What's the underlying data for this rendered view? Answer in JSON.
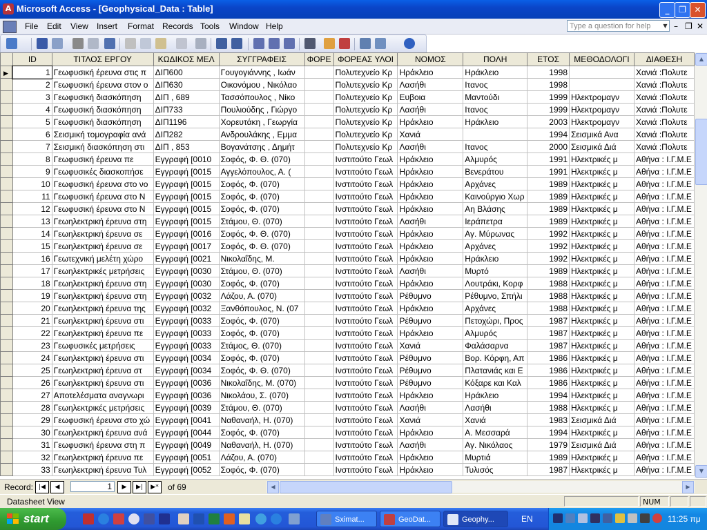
{
  "window": {
    "title": "Microsoft Access - [Geophysical_Data : Table]",
    "minimize_label": "_",
    "restore_label": "❐",
    "close_label": "✕"
  },
  "menu": {
    "items": [
      "File",
      "Edit",
      "View",
      "Insert",
      "Format",
      "Records",
      "Tools",
      "Window",
      "Help"
    ],
    "help_placeholder": "Type a question for help",
    "mdi_minimize": "–",
    "mdi_restore": "❐",
    "mdi_close": "✕"
  },
  "toolbar": {
    "icons": [
      "view-design-icon",
      "save-icon",
      "file-search-icon",
      "print-icon",
      "print-preview-icon",
      "spelling-icon",
      "cut-icon",
      "copy-icon",
      "paste-icon",
      "undo-icon",
      "insert-hyperlink-icon",
      "sort-ascending-icon",
      "sort-descending-icon",
      "filter-by-selection-icon",
      "filter-by-form-icon",
      "apply-filter-icon",
      "find-icon",
      "new-record-icon",
      "delete-record-icon",
      "properties-icon",
      "new-object-icon",
      "help-icon"
    ]
  },
  "table": {
    "columns": [
      "ID",
      "ΤΙΤΛΟΣ ΕΡΓΟΥ",
      "ΚΩΔΙΚΟΣ ΜΕΛ",
      "ΣΥΓΓΡΑΦΕΙΣ",
      "ΦΟΡΕ",
      "ΦΟΡΕΑΣ ΥΛΟΙ",
      "ΝΟΜΟΣ",
      "ΠΟΛΗ",
      "ΕΤΟΣ",
      "ΜΕΘΟΔΟΛΟΓΙ",
      "ΔΙΑΘΕΣΗ"
    ],
    "rows": [
      [
        "1",
        "Γεωφυσική έρευνα στις π",
        "ΔΙΠ600",
        "Γουγογιάννης , Ιωάν",
        "",
        "Πολυτεχνείο Κρ",
        "Ηράκλειο",
        "Ηράκλειο",
        "1998",
        "",
        "Χανιά :Πολυτε"
      ],
      [
        "2",
        "Γεωφυσική έρευνα στον ο",
        "ΔΙΠ630",
        "Οικονόμου , Νικόλαο",
        "",
        "Πολυτεχνείο Κρ",
        "Λασήθι",
        "Ιτανος",
        "1998",
        "",
        "Χανιά :Πολυτε"
      ],
      [
        "3",
        "Γεωφυσική διασκόπηση",
        "ΔΙΠ , 689",
        "Τασσόπουλος , Νίκο",
        "",
        "Πολυτεχνείο Κρ",
        "Ευβοια",
        "Μαντούδι",
        "1999",
        "Ηλεκτρομαγν",
        "Χανιά :Πολυτε"
      ],
      [
        "4",
        "Γεωφυσική διασκόπηση",
        "ΔΙΠ733",
        "Πουλιούδης , Γιώργο",
        "",
        "Πολυτεχνείο Κρ",
        "Λασήθι",
        "Ιτανος",
        "1999",
        "Ηλεκτρομαγν",
        "Χανιά :Πολυτε"
      ],
      [
        "5",
        "Γεωφυσική διασκόπηση",
        "ΔΙΠ1196",
        "Χορευτάκη , Γεωργία",
        "",
        "Πολυτεχνείο Κρ",
        "Ηράκλειο",
        "Ηράκλειο",
        "2003",
        "Ηλεκτρομαγν",
        "Χανιά :Πολυτε"
      ],
      [
        "6",
        "Σεισμική τομογραφία ανά",
        "ΔΙΠ282",
        "Ανδρουλάκης , Εμμα",
        "",
        "Πολυτεχνείο Κρ",
        "Χανιά",
        "",
        "1994",
        "Σεισμικά Ανα",
        "Χανιά :Πολυτε"
      ],
      [
        "7",
        "Σεισμική διασκόπηση στι",
        "ΔΙΠ , 853",
        "Βογανάτσης , Δημήτ",
        "",
        "Πολυτεχνείο Κρ",
        "Λασήθι",
        "Ιτανος",
        "2000",
        "Σεισμικά Διά",
        "Χανιά :Πολυτε"
      ],
      [
        "8",
        "Γεωφυσική έρευνα πε",
        "Εγγραφή [0010",
        "Σοφός, Φ. Θ. (070)",
        "",
        "Ινστιτούτο Γεωλ",
        "Ηράκλειο",
        "Αλμυρός",
        "1991",
        "Ηλεκτρικές μ",
        "Αθήνα : Ι.Γ.Μ.Ε"
      ],
      [
        "9",
        "Γεωφυσικές διασκοπήσε",
        "Εγγραφή [0015",
        "Αγγελόπουλος, Α. (",
        "",
        "Ινστιτούτο Γεωλ",
        "Ηράκλειο",
        "Βενεράτου",
        "1991",
        "Ηλεκτρικές μ",
        "Αθήνα : Ι.Γ.Μ.Ε"
      ],
      [
        "10",
        "Γεωφυσική έρευνα στο νο",
        "Εγγραφή [0015",
        "Σοφός, Φ. (070)",
        "",
        "Ινστιτούτο Γεωλ",
        "Ηράκλειο",
        "Αρχάνες",
        "1989",
        "Ηλεκτρικές μ",
        "Αθήνα : Ι.Γ.Μ.Ε"
      ],
      [
        "11",
        "Γεωφυσική έρευνα στο Ν",
        "Εγγραφή [0015",
        "Σοφός, Φ. (070)",
        "",
        "Ινστιτούτο Γεωλ",
        "Ηράκλειο",
        "Καινούργιο Χωρ",
        "1989",
        "Ηλεκτρικές μ",
        "Αθήνα : Ι.Γ.Μ.Ε"
      ],
      [
        "12",
        "Γεωφυσική έρευνα στο Ν",
        "Εγγραφή [0015",
        "Σοφός, Φ. (070)",
        "",
        "Ινστιτούτο Γεωλ",
        "Ηράκλειο",
        "Αη Βλάσης",
        "1989",
        "Ηλεκτρικές μ",
        "Αθήνα : Ι.Γ.Μ.Ε"
      ],
      [
        "13",
        "Γεωηλεκτρική έρευνα στη",
        "Εγγραφή [0015",
        "Στάμου, Θ. (070)",
        "",
        "Ινστιτούτο Γεωλ",
        "Λασήθι",
        "Ιεράπετρα",
        "1989",
        "Ηλεκτρικές μ",
        "Αθήνα : Ι.Γ.Μ.Ε"
      ],
      [
        "14",
        "Γεωηλεκτρική έρευνα σε",
        "Εγγραφή [0016",
        "Σοφός, Φ. Θ. (070)",
        "",
        "Ινστιτούτο Γεωλ",
        "Ηράκλειο",
        "Αγ. Μύρωνας",
        "1992",
        "Ηλεκτρικές μ",
        "Αθήνα : Ι.Γ.Μ.Ε"
      ],
      [
        "15",
        "Γεωηλεκτρική έρευνα σε",
        "Εγγραφή [0017",
        "Σοφός, Φ. Θ. (070)",
        "",
        "Ινστιτούτο Γεωλ",
        "Ηράκλειο",
        "Αρχάνες",
        "1992",
        "Ηλεκτρικές μ",
        "Αθήνα : Ι.Γ.Μ.Ε"
      ],
      [
        "16",
        "Γεωτεχνική μελέτη χώρο",
        "Εγγραφή [0021",
        "Νικολαΐδης, Μ.",
        "",
        "Ινστιτούτο Γεωλ",
        "Ηράκλειο",
        "Ηράκλειο",
        "1992",
        "Ηλεκτρικές μ",
        "Αθήνα : Ι.Γ.Μ.Ε"
      ],
      [
        "17",
        "Γεωηλεκτρικές μετρήσεις",
        "Εγγραφή [0030",
        "Στάμου, Θ. (070)",
        "",
        "Ινστιτούτο Γεωλ",
        "Λασήθι",
        "Μυρτό",
        "1989",
        "Ηλεκτρικές μ",
        "Αθήνα : Ι.Γ.Μ.Ε"
      ],
      [
        "18",
        "Γεωηλεκτρική έρευνα στη",
        "Εγγραφή [0030",
        "Σοφός, Φ. (070)",
        "",
        "Ινστιτούτο Γεωλ",
        "Ηράκλειο",
        "Λουτράκι, Κορφ",
        "1988",
        "Ηλεκτρικές μ",
        "Αθήνα : Ι.Γ.Μ.Ε"
      ],
      [
        "19",
        "Γεωηλεκτρική έρευνα στη",
        "Εγγραφή [0032",
        "Λάζου, Α. (070)",
        "",
        "Ινστιτούτο Γεωλ",
        "Ρέθυμνο",
        "Ρέθυμνο, Σπήλι",
        "1988",
        "Ηλεκτρικές μ",
        "Αθήνα : Ι.Γ.Μ.Ε"
      ],
      [
        "20",
        "Γεωηλεκτρική έρευνα της",
        "Εγγραφή [0032",
        "Ξανθόπουλος, Ν. (07",
        "",
        "Ινστιτούτο Γεωλ",
        "Ηράκλειο",
        "Αρχάνες",
        "1988",
        "Ηλεκτρικές μ",
        "Αθήνα : Ι.Γ.Μ.Ε"
      ],
      [
        "21",
        "Γεωηλεκτρική έρευνα στι",
        "Εγγραφή [0033",
        "Σοφός, Φ. (070)",
        "",
        "Ινστιτούτο Γεωλ",
        "Ρέθυμνο",
        "Πετοχώρι, Προς",
        "1987",
        "Ηλεκτρικές μ",
        "Αθήνα : Ι.Γ.Μ.Ε"
      ],
      [
        "22",
        "Γεωηλεκτρική έρευνα πε",
        "Εγγραφή [0033",
        "Σοφός, Φ. (070)",
        "",
        "Ινστιτούτο Γεωλ",
        "Ηράκλειο",
        "Αλμυρός",
        "1987",
        "Ηλεκτρικές μ",
        "Αθήνα : Ι.Γ.Μ.Ε"
      ],
      [
        "23",
        "Γεωφυσικές μετρήσεις",
        "Εγγραφή [0033",
        "Στάμος, Θ. (070)",
        "",
        "Ινστιτούτο Γεωλ",
        "Χανιά",
        "Φαλάσαρνα",
        "1987",
        "Ηλεκτρικές μ",
        "Αθήνα : Ι.Γ.Μ.Ε"
      ],
      [
        "24",
        "Γεωηλεκτρική έρευνα στι",
        "Εγγραφή [0034",
        "Σοφός, Φ. (070)",
        "",
        "Ινστιτούτο Γεωλ",
        "Ρέθυμνο",
        "Βορ. Κόρφη, Απ",
        "1986",
        "Ηλεκτρικές μ",
        "Αθήνα : Ι.Γ.Μ.Ε"
      ],
      [
        "25",
        "Γεωηλεκτρική έρευνα στ",
        "Εγγραφή [0034",
        "Σοφός, Φ. Θ. (070)",
        "",
        "Ινστιτούτο Γεωλ",
        "Ρέθυμνο",
        "Πλατανιάς και Ε",
        "1986",
        "Ηλεκτρικές μ",
        "Αθήνα : Ι.Γ.Μ.Ε"
      ],
      [
        "26",
        "Γεωηλεκτρική έρευνα στι",
        "Εγγραφή [0036",
        "Νικολαΐδης, Μ. (070)",
        "",
        "Ινστιτούτο Γεωλ",
        "Ρέθυμνο",
        "Κόξαρε και Καλ",
        "1986",
        "Ηλεκτρικές μ",
        "Αθήνα : Ι.Γ.Μ.Ε"
      ],
      [
        "27",
        "Αποτελέσματα αναγνωρι",
        "Εγγραφή [0036",
        "Νικολάου, Σ. (070)",
        "",
        "Ινστιτούτο Γεωλ",
        "Ηράκλειο",
        "Ηράκλειο",
        "1994",
        "Ηλεκτρικές μ",
        "Αθήνα : Ι.Γ.Μ.Ε"
      ],
      [
        "28",
        "Γεωηλεκτρικές μετρήσεις",
        "Εγγραφή [0039",
        "Στάμου, Θ. (070)",
        "",
        "Ινστιτούτο Γεωλ",
        "Λασήθι",
        "Λασήθι",
        "1988",
        "Ηλεκτρικές μ",
        "Αθήνα : Ι.Γ.Μ.Ε"
      ],
      [
        "29",
        "Γεωφυσική έρευνα στο χώ",
        "Εγγραφή [0041",
        "Ναθαναήλ, Η. (070)",
        "",
        "Ινστιτούτο Γεωλ",
        "Χανιά",
        "Χανιά",
        "1983",
        "Σεισμικά Διά",
        "Αθήνα : Ι.Γ.Μ.Ε"
      ],
      [
        "30",
        "Γεωηλεκτρική έρευνα ανά",
        "Εγγραφή [0044",
        "Σοφός, Φ. (070)",
        "",
        "Ινστιτούτο Γεωλ",
        "Ηράκλειο",
        "Α. Μεσσαρά",
        "1994",
        "Ηλεκτρικές μ",
        "Αθήνα : Ι.Γ.Μ.Ε"
      ],
      [
        "31",
        "Γεωφυσική έρευνα στη π",
        "Εγγραφή [0049",
        "Ναθαναήλ, Η. (070)",
        "",
        "Ινστιτούτο Γεωλ",
        "Λασήθι",
        "Αγ. Νικόλαος",
        "1979",
        "Σεισμικά Διά",
        "Αθήνα : Ι.Γ.Μ.Ε"
      ],
      [
        "32",
        "Γεωηλεκτρική έρευνα πε",
        "Εγγραφή [0051",
        "Λάζου, Α. (070)",
        "",
        "Ινστιτούτο Γεωλ",
        "Ηράκλειο",
        "Μυρτιά",
        "1989",
        "Ηλεκτρικές μ",
        "Αθήνα : Ι.Γ.Μ.Ε"
      ],
      [
        "33",
        "Γεωηλεκτρική έρευνα Τυλ",
        "Εγγραφή [0052",
        "Σοφός, Φ. (070)",
        "",
        "Ινστιτούτο Γεωλ",
        "Ηράκλειο",
        "Τυλισός",
        "1987",
        "Ηλεκτρικές μ",
        "Αθήνα : Ι.Γ.Μ.Ε"
      ]
    ]
  },
  "navigation": {
    "record_label": "Record:",
    "current_record": "1",
    "of_label": "of  69",
    "first_icon": "first-record-icon",
    "prev_icon": "previous-record-icon",
    "next_icon": "next-record-icon",
    "last_icon": "last-record-icon",
    "new_icon": "new-record-icon"
  },
  "status": {
    "view": "Datasheet View",
    "num_indicator": "NUM"
  },
  "taskbar": {
    "start_label": "start",
    "tasks": [
      "Sximat...",
      "GeoDat...",
      "Geophy..."
    ],
    "language": "EN",
    "clock": "11:25 πμ"
  }
}
